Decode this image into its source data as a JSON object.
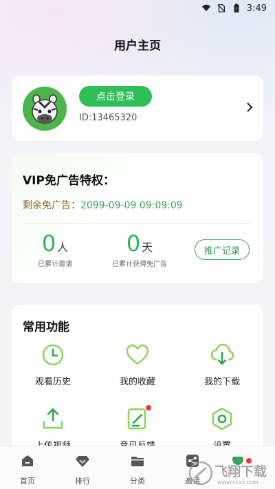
{
  "status_bar": {
    "time": "3:49"
  },
  "page": {
    "title": "用户主页"
  },
  "profile": {
    "login_label": "点击登录",
    "user_id": "ID:13465320"
  },
  "vip": {
    "title": "VIP免广告特权：",
    "remain_label": "剩余免广告：",
    "remain_value": "2099-09-09 09:09:09",
    "invited_count": "0",
    "invited_unit": "人",
    "invited_caption": "已累计邀请",
    "days_count": "0",
    "days_unit": "天",
    "days_caption": "已累计获得免广告",
    "promo_button": "推广记录"
  },
  "functions": {
    "title": "常用功能",
    "items": [
      {
        "label": "观看历史",
        "icon": "clock-icon"
      },
      {
        "label": "我的收藏",
        "icon": "heart-icon"
      },
      {
        "label": "我的下载",
        "icon": "cloud-download-icon"
      },
      {
        "label": "上传视频",
        "icon": "upload-icon"
      },
      {
        "label": "意见反馈",
        "icon": "feedback-edit-icon"
      },
      {
        "label": "设置",
        "icon": "settings-hexagon-icon"
      }
    ]
  },
  "tabs": [
    {
      "label": "首页",
      "icon": "home-icon"
    },
    {
      "label": "排行",
      "icon": "diamond-icon"
    },
    {
      "label": "分类",
      "icon": "folder-icon"
    },
    {
      "label": "邀请",
      "icon": "share-icon"
    }
  ],
  "watermark": {
    "text": "飞翔下载",
    "sub": "WWW.FXXZ.COM"
  },
  "colors": {
    "accent": "#2fbf57",
    "accent_text": "#3aa55a",
    "gold_text": "#8a6a2b"
  }
}
